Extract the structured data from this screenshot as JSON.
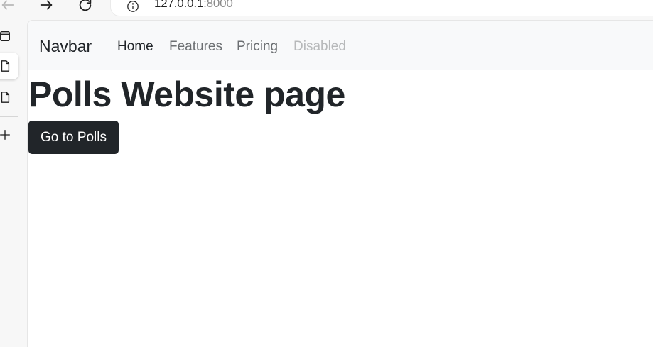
{
  "browser": {
    "url_host": "127.0.0.1",
    "url_port": ":8000"
  },
  "navbar": {
    "brand": "Navbar",
    "links": [
      {
        "label": "Home",
        "state": "active"
      },
      {
        "label": "Features",
        "state": "normal"
      },
      {
        "label": "Pricing",
        "state": "normal"
      },
      {
        "label": "Disabled",
        "state": "disabled"
      }
    ]
  },
  "main": {
    "heading": "Polls Website page",
    "button_label": "Go to Polls"
  },
  "colors": {
    "dark": "#212529",
    "navbar_bg": "#f8f9fa",
    "muted_link": "rgba(33,37,41,0.65)",
    "disabled_link": "rgba(33,37,41,0.3)"
  },
  "icons": [
    "back-icon",
    "forward-icon",
    "reload-icon",
    "info-icon",
    "tab-overview-icon",
    "page-icon",
    "page-icon",
    "plus-icon"
  ]
}
